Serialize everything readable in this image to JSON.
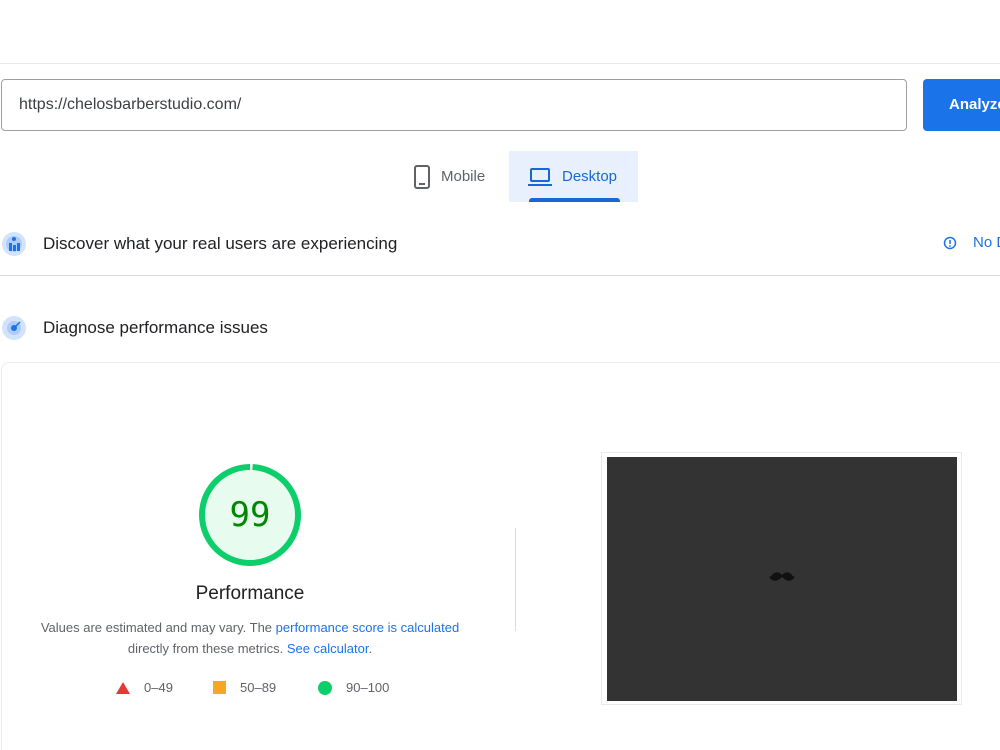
{
  "url_bar": {
    "value": "https://chelosbarberstudio.com/",
    "button_label": "Analyze"
  },
  "device_tabs": [
    {
      "label": "Mobile",
      "selected": false
    },
    {
      "label": "Desktop",
      "selected": true
    }
  ],
  "crux_section": {
    "title": "Discover what your real users are experiencing",
    "status_text": "No Data"
  },
  "diagnose_section": {
    "title": "Diagnose performance issues"
  },
  "performance": {
    "score": "99",
    "score_fraction": 0.99,
    "title": "Performance",
    "description_prefix": "Values are estimated and may vary. The ",
    "score_link": "performance score is calculated",
    "description_middle": " directly from these metrics. ",
    "calculator_link": "See calculator",
    "description_suffix": "."
  },
  "legend": [
    {
      "range": "0–49",
      "shape": "triangle",
      "color": "#e53935"
    },
    {
      "range": "50–89",
      "shape": "square",
      "color": "#f4a825"
    },
    {
      "range": "90–100",
      "shape": "circle",
      "color": "#0cce6b"
    }
  ],
  "colors": {
    "accent": "#1a73e8",
    "tab_selected_bg": "#e8f0fe",
    "score_good": "#0cce6b",
    "score_text": "#008800",
    "screenshot_bg": "#333333"
  }
}
